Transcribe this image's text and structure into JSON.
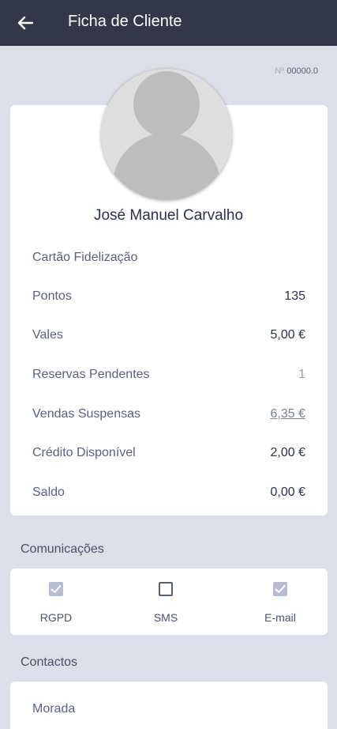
{
  "header": {
    "title": "Ficha de Cliente",
    "back_icon": "arrow-left-icon"
  },
  "client": {
    "number_label": "Nº",
    "number": "00000.0",
    "name": "José Manuel Carvalho",
    "avatar_icon": "person-placeholder-icon"
  },
  "info": {
    "loyalty_card_label": "Cartão Fidelização",
    "rows": [
      {
        "label": "Pontos",
        "value": "135"
      },
      {
        "label": "Vales",
        "value": "5,00 €"
      },
      {
        "label": "Reservas Pendentes",
        "value": "1"
      },
      {
        "label": "Vendas Suspensas",
        "value": "6,35 €"
      },
      {
        "label": "Crédito Disponível",
        "value": "2,00 €"
      },
      {
        "label": "Saldo",
        "value": "0,00 €"
      }
    ]
  },
  "communications": {
    "title": "Comunicações",
    "items": [
      {
        "label": "RGPD",
        "checked": true
      },
      {
        "label": "SMS",
        "checked": false
      },
      {
        "label": "E-mail",
        "checked": true
      }
    ]
  },
  "contacts": {
    "title": "Contactos",
    "address_label": "Morada"
  },
  "colors": {
    "appbar": "#34374a",
    "background": "#dcdee8",
    "checked": "#b8bdd4"
  }
}
